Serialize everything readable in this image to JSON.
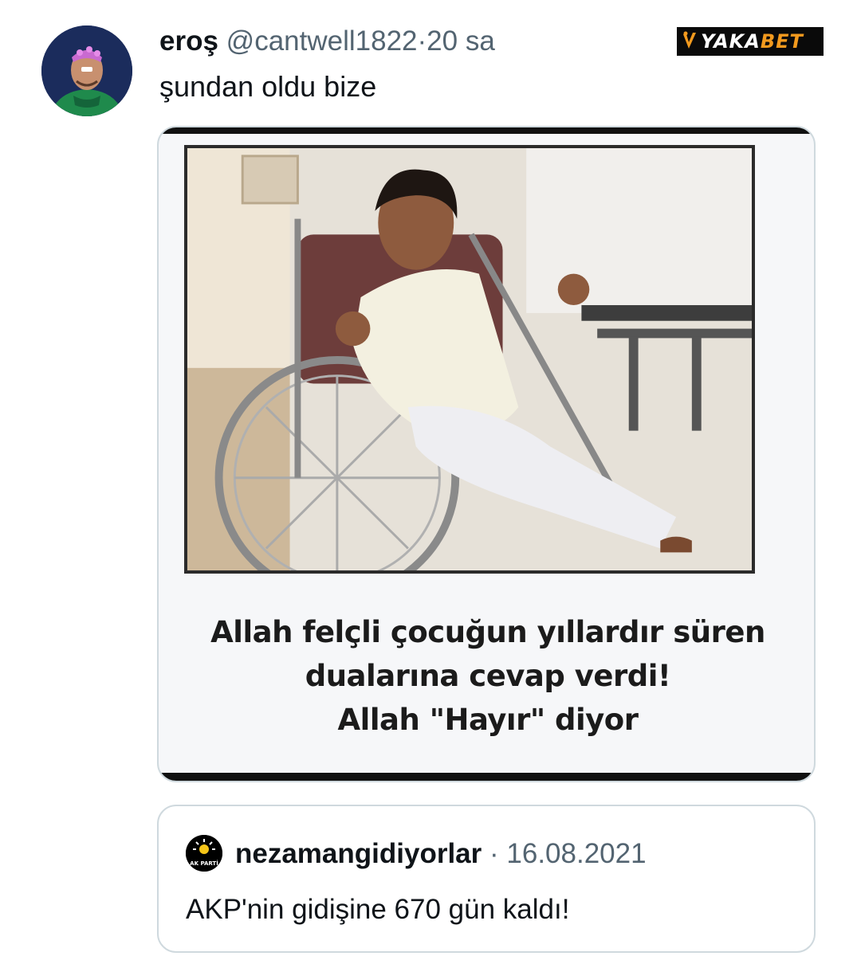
{
  "tweet": {
    "display_name": "eroş",
    "handle": "@cantwell1822",
    "separator": "·",
    "time": "20 sa",
    "text": "şundan oldu bize",
    "avatar_icon": "user-avatar-photo"
  },
  "watermark": {
    "text_part1": "YAKA",
    "text_part2": "BET",
    "accent_color": "#f39a1e"
  },
  "media": {
    "photo_icon": "photo-child-wheelchair",
    "caption_lines": [
      "Allah felçli çocuğun yıllardır süren",
      "dualarına cevap verdi!",
      "Allah \"Hayır\" diyor"
    ]
  },
  "quoted_tweet": {
    "avatar_icon": "ak-parti-logo",
    "avatar_label": "AK PARTİ",
    "display_name": "nezamangidiyorlar",
    "separator": "·",
    "date": "16.08.2021",
    "text": "AKP'nin gidişine 670 gün kaldı!"
  }
}
